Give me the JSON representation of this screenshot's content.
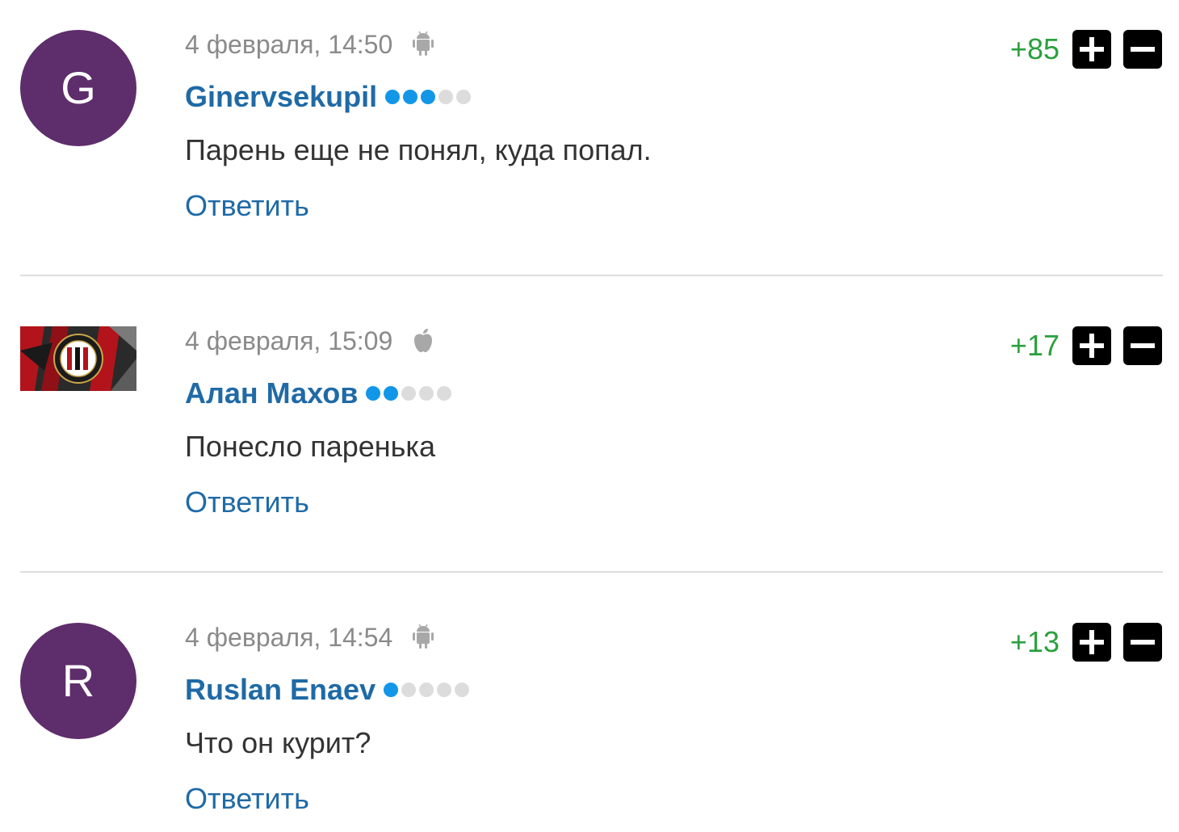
{
  "comments": [
    {
      "avatar_letter": "G",
      "date": "4 февраля, 14:50",
      "device_icon": "android-icon",
      "author": "Ginervsekupil",
      "level": 3,
      "text": "Парень еще не понял, куда попал.",
      "reply_label": "Ответить",
      "rating": "+85"
    },
    {
      "avatar_letter": "",
      "date": "4 февраля, 15:09",
      "device_icon": "apple-icon",
      "author": "Алан Махов",
      "level": 2,
      "text": "Понесло паренька",
      "reply_label": "Ответить",
      "rating": "+17"
    },
    {
      "avatar_letter": "R",
      "date": "4 февраля, 14:54",
      "device_icon": "android-icon",
      "author": "Ruslan Enaev",
      "level": 1,
      "text": "Что он курит?",
      "reply_label": "Ответить",
      "rating": "+13"
    }
  ],
  "colors": {
    "avatar": "#5e2d6b",
    "author": "#1f6aa6",
    "rating": "#2aa03e",
    "level_on": "#1296e8",
    "level_off": "#dcdcdc"
  }
}
